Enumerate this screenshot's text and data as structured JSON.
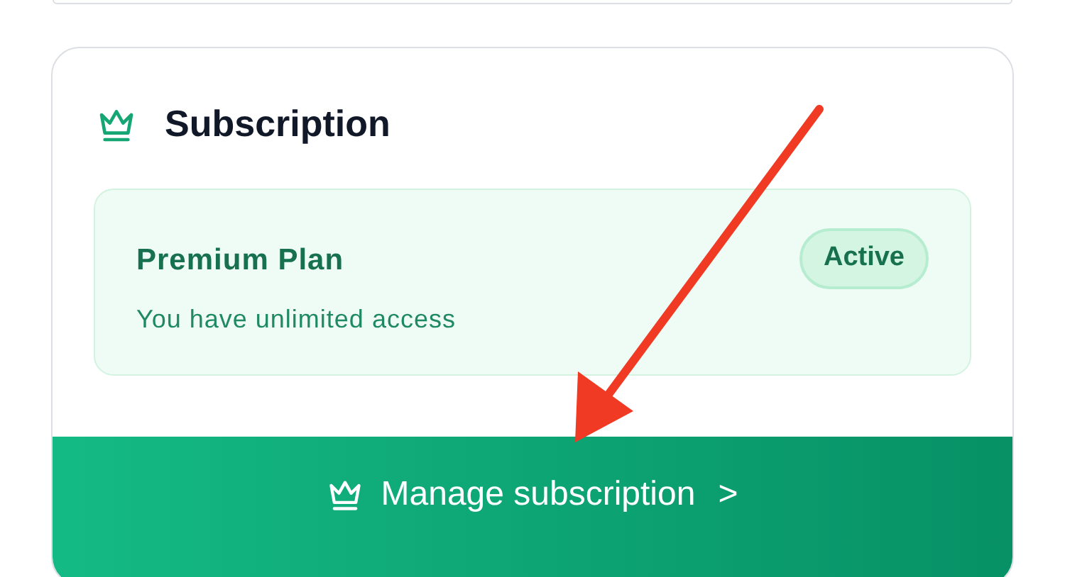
{
  "subscription": {
    "title": "Subscription",
    "plan": {
      "name": "Premium Plan",
      "status": "Active",
      "description": "You have unlimited access"
    },
    "action": {
      "label": "Manage subscription",
      "chevron": ">"
    }
  }
}
